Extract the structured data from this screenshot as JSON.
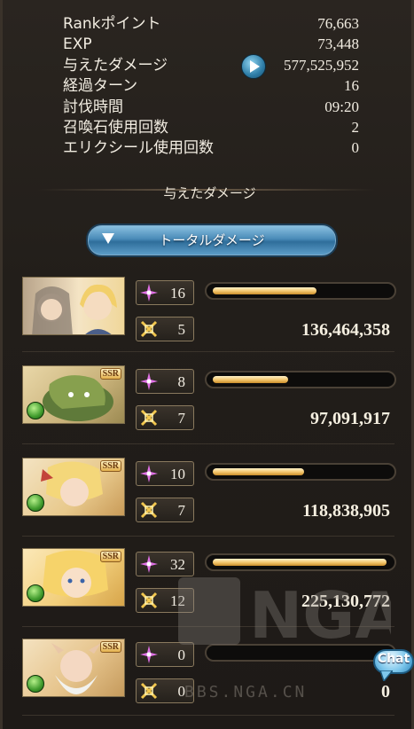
{
  "stats": [
    {
      "label": "Rankポイント",
      "value": "76,663"
    },
    {
      "label": "EXP",
      "value": "73,448"
    },
    {
      "label": "与えたダメージ",
      "value": "577,525,952"
    },
    {
      "label": "経過ターン",
      "value": "16"
    },
    {
      "label": "討伐時間",
      "value": "09:20"
    },
    {
      "label": "召喚石使用回数",
      "value": "2"
    },
    {
      "label": "エリクシール使用回数",
      "value": "0"
    }
  ],
  "section_title": "与えたダメージ",
  "dropdown": {
    "selected": "トータルダメージ"
  },
  "characters": [
    {
      "skill_count": "16",
      "ougi_count": "5",
      "bar_fill": 0.58,
      "damage": "136,464,358",
      "ssr": "",
      "element": ""
    },
    {
      "skill_count": "8",
      "ougi_count": "7",
      "bar_fill": 0.42,
      "damage": "97,091,917",
      "ssr": "SSR",
      "element": "wind"
    },
    {
      "skill_count": "10",
      "ougi_count": "7",
      "bar_fill": 0.51,
      "damage": "118,838,905",
      "ssr": "SSR",
      "element": "wind"
    },
    {
      "skill_count": "32",
      "ougi_count": "12",
      "bar_fill": 0.97,
      "damage": "225,130,772",
      "ssr": "SSR",
      "element": "wind"
    },
    {
      "skill_count": "0",
      "ougi_count": "0",
      "bar_fill": 0,
      "damage": "0",
      "ssr": "SSR",
      "element": "wind"
    }
  ],
  "chat_button": {
    "label": "Chat"
  },
  "watermark": {
    "text": "BBS.NGA.CN",
    "logo": "NGA"
  },
  "colors": {
    "bar_fill": "#f2c46a",
    "accent_blue": "#4a8bb8",
    "element_wind": "#3f9a2c"
  }
}
